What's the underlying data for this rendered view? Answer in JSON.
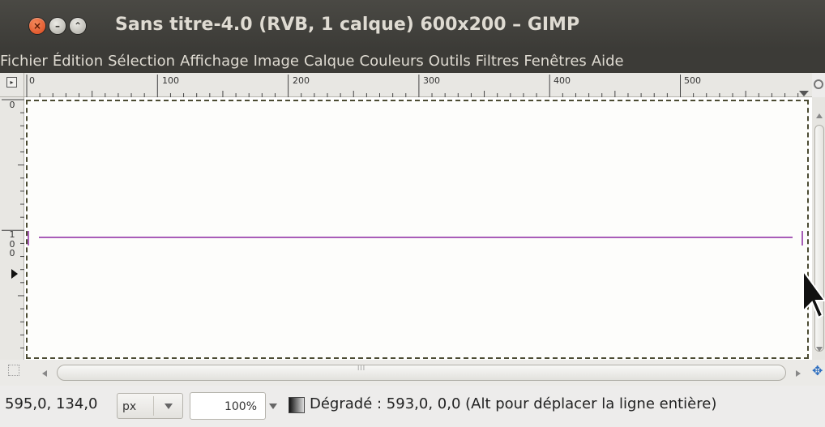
{
  "window": {
    "title": "Sans titre-4.0 (RVB, 1 calque) 600x200 – GIMP",
    "buttons": {
      "close": "×",
      "minimize": "–",
      "maximize": "⌃"
    }
  },
  "menu": [
    "Fichier",
    "Édition",
    "Sélection",
    "Affichage",
    "Image",
    "Calque",
    "Couleurs",
    "Outils",
    "Filtres",
    "Fenêtres",
    "Aide"
  ],
  "rulers": {
    "horizontal_labels": [
      "0",
      "100",
      "200",
      "300",
      "400",
      "500"
    ],
    "vertical_top_label": "0",
    "vertical_mid_label": [
      "1",
      "0",
      "0"
    ]
  },
  "colors": {
    "guide": "#a85db8",
    "titlebar": "#3c3b37",
    "selection_border": "#4b4b32"
  },
  "statusbar": {
    "coordinates": "595,0, 134,0",
    "unit": "px",
    "zoom": "100%",
    "message": "Dégradé : 593,0, 0,0 (Alt pour déplacer la ligne entière)"
  },
  "scroll": {
    "grip": "III"
  },
  "icons": {
    "navigate": "✥",
    "zoom_toggle": "magnifier-icon",
    "gradient": "gradient-icon"
  }
}
